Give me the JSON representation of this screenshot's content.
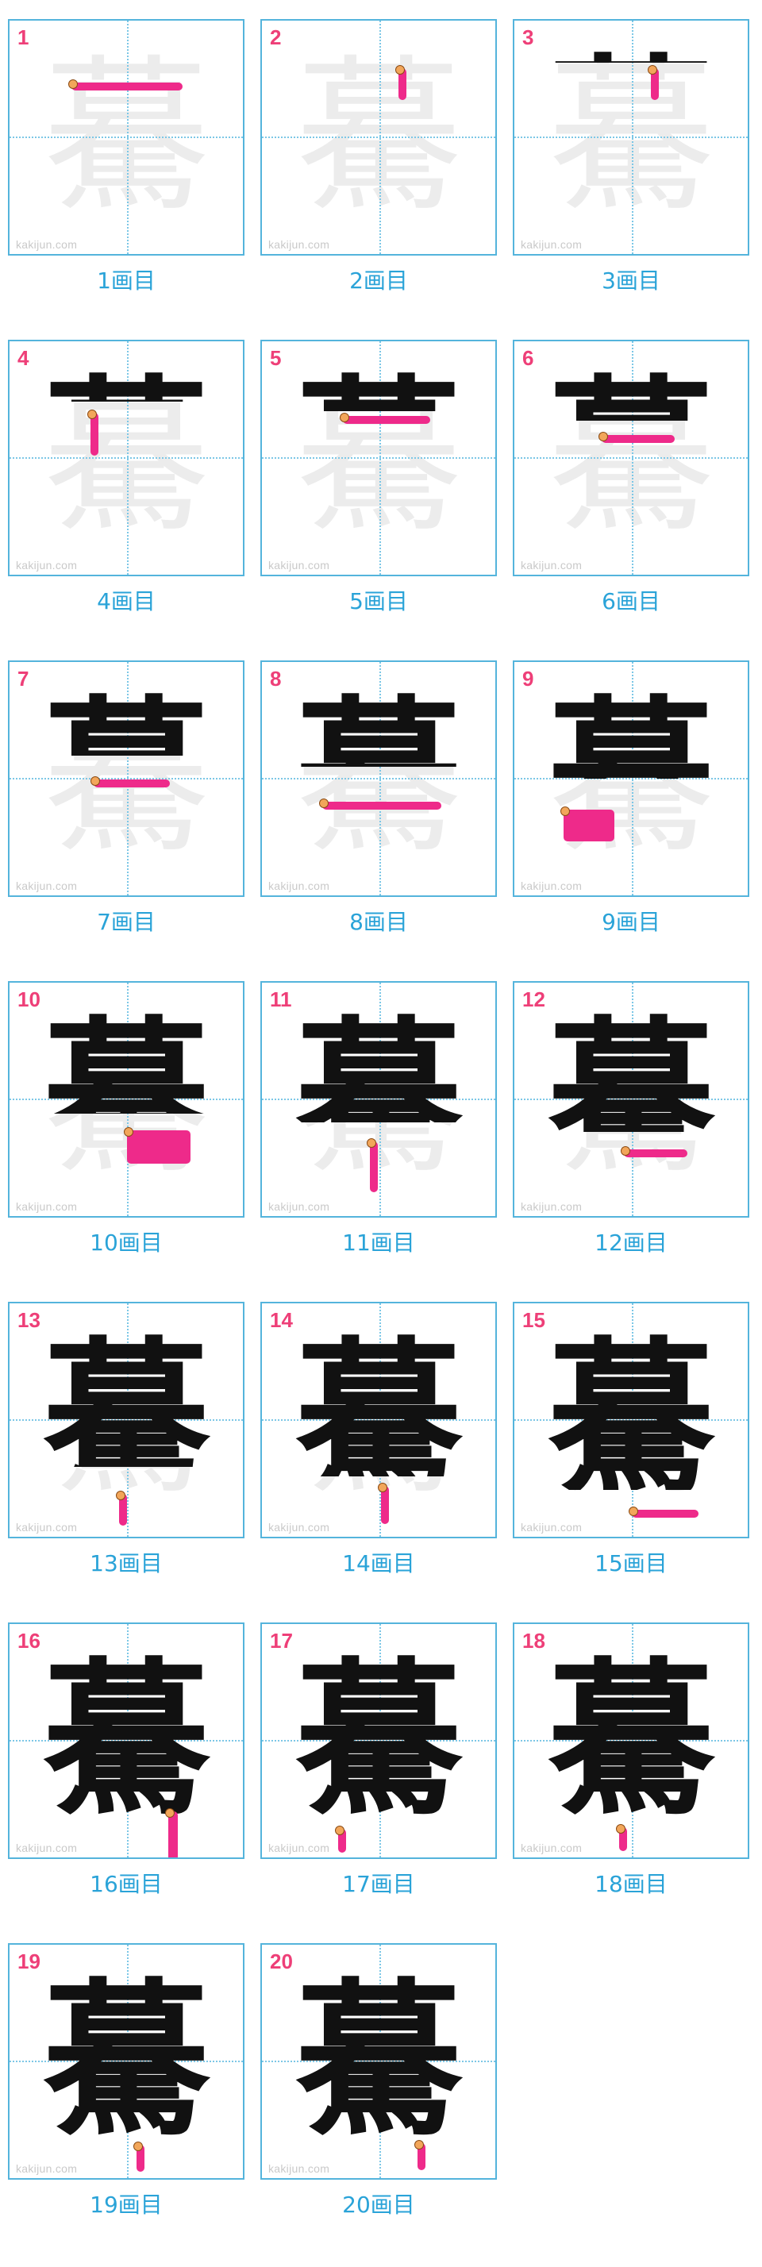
{
  "character": "驀",
  "watermark": "kakijun.com",
  "colors": {
    "border": "#54b4dc",
    "caption": "#2aa3d8",
    "number": "#ee3f78",
    "stroke_highlight": "#ee2a8a",
    "ink": "#111111",
    "ghost": "#ececec"
  },
  "panels": [
    {
      "num": "1",
      "caption": "1画目"
    },
    {
      "num": "2",
      "caption": "2画目"
    },
    {
      "num": "3",
      "caption": "3画目"
    },
    {
      "num": "4",
      "caption": "4画目"
    },
    {
      "num": "5",
      "caption": "5画目"
    },
    {
      "num": "6",
      "caption": "6画目"
    },
    {
      "num": "7",
      "caption": "7画目"
    },
    {
      "num": "8",
      "caption": "8画目"
    },
    {
      "num": "9",
      "caption": "9画目"
    },
    {
      "num": "10",
      "caption": "10画目"
    },
    {
      "num": "11",
      "caption": "11画目"
    },
    {
      "num": "12",
      "caption": "12画目"
    },
    {
      "num": "13",
      "caption": "13画目"
    },
    {
      "num": "14",
      "caption": "14画目"
    },
    {
      "num": "15",
      "caption": "15画目"
    },
    {
      "num": "16",
      "caption": "16画目"
    },
    {
      "num": "17",
      "caption": "17画目"
    },
    {
      "num": "18",
      "caption": "18画目"
    },
    {
      "num": "19",
      "caption": "19画目"
    },
    {
      "num": "20",
      "caption": "20画目"
    }
  ]
}
